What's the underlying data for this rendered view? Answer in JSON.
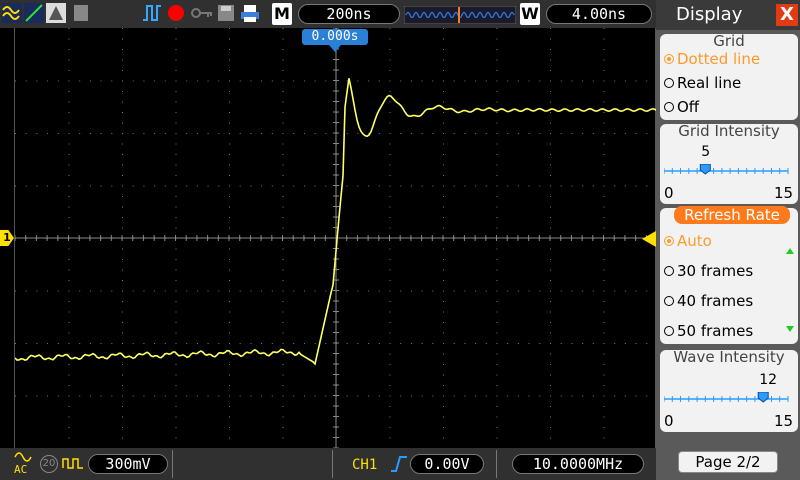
{
  "topbar": {
    "icons": [
      "wave-yellow-icon",
      "wave-green-icon",
      "persist-icon",
      "pulse-trigger-icon",
      "record-icon",
      "key-icon",
      "save-icon",
      "print-icon"
    ],
    "timebase_mode": "M",
    "timebase": "200ns",
    "trigger_mode": "W",
    "trigger_value": "4.00ns",
    "colors": {
      "record": "#ff0000",
      "pulse": "#00aaff",
      "yellow": "#ffe000",
      "green": "#33dd33"
    }
  },
  "screen": {
    "time_offset": "0.000s",
    "channel_marker": "1",
    "trace_color": "#ffff66"
  },
  "bottombar": {
    "coupling": "AC",
    "bw_label": "20",
    "volt_div": "300mV",
    "channel": "CH1",
    "trigger_level": "0.00V",
    "frequency": "10.0000MHz"
  },
  "panel": {
    "title": "Display",
    "close": "X",
    "grid": {
      "label": "Grid",
      "options": [
        "Dotted line",
        "Real line",
        "Off"
      ],
      "selected": 0
    },
    "grid_intensity": {
      "label": "Grid Intensity",
      "value": "5",
      "min": "0",
      "max": "15",
      "fraction": 0.333
    },
    "refresh_rate": {
      "label": "Refresh Rate",
      "options": [
        "Auto",
        "30 frames",
        "40 frames",
        "50 frames"
      ],
      "selected": 0
    },
    "wave_intensity": {
      "label": "Wave Intensity",
      "value": "12",
      "min": "0",
      "max": "15",
      "fraction": 0.8
    },
    "page": "Page 2/2"
  }
}
